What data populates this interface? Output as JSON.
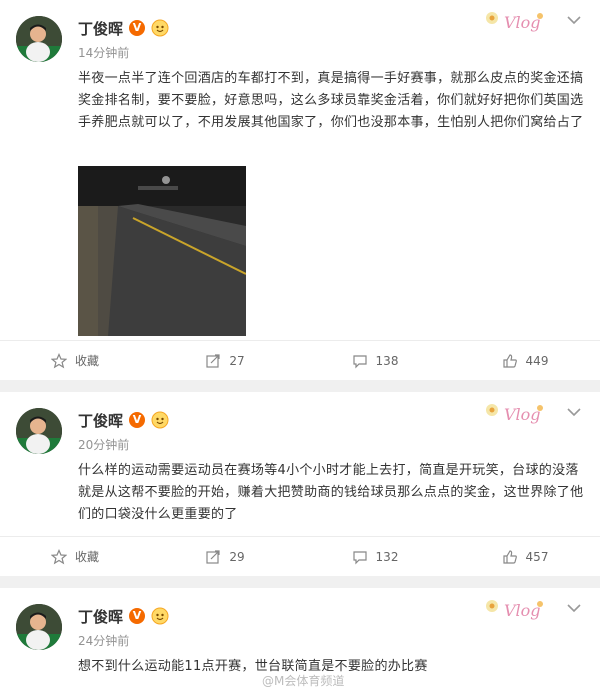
{
  "posts": [
    {
      "username": "丁俊晖",
      "verified_badge": "V",
      "time": "14分钟前",
      "text": "半夜一点半了连个回酒店的车都打不到，真是搞得一手好赛事，就那么皮点的奖金还搞奖金排名制，要不要脸，好意思吗，这么多球员靠奖金活着，你们就好好把你们英国选手养肥点就可以了，不用发展其他国家了，你们也没那本事，生怕别人把你们窝给占了",
      "favorite_label": "收藏",
      "reposts": "27",
      "comments": "138",
      "likes": "449"
    },
    {
      "username": "丁俊晖",
      "verified_badge": "V",
      "time": "20分钟前",
      "text": "什么样的运动需要运动员在赛场等4小个小时才能上去打，简直是开玩笑，台球的没落就是从这帮不要脸的开始，赚着大把赞助商的钱给球员那么点点的奖金，这世界除了他们的口袋没什么更重要的了",
      "favorite_label": "收藏",
      "reposts": "29",
      "comments": "132",
      "likes": "457"
    },
    {
      "username": "丁俊晖",
      "verified_badge": "V",
      "time": "24分钟前",
      "text": "想不到什么运动能11点开赛，世台联简直是不要脸的办比赛"
    }
  ],
  "watermark": "@M会体育频道",
  "colors": {
    "background": "#f0f0f0",
    "card": "#ffffff",
    "badge": "#f56a00",
    "meta": "#939393"
  },
  "icons": [
    "avatar",
    "verified-icon",
    "fan-badge-icon",
    "vlog-sticker-icon",
    "chevron-down-icon",
    "star-icon",
    "repost-icon",
    "comment-icon",
    "like-icon"
  ]
}
